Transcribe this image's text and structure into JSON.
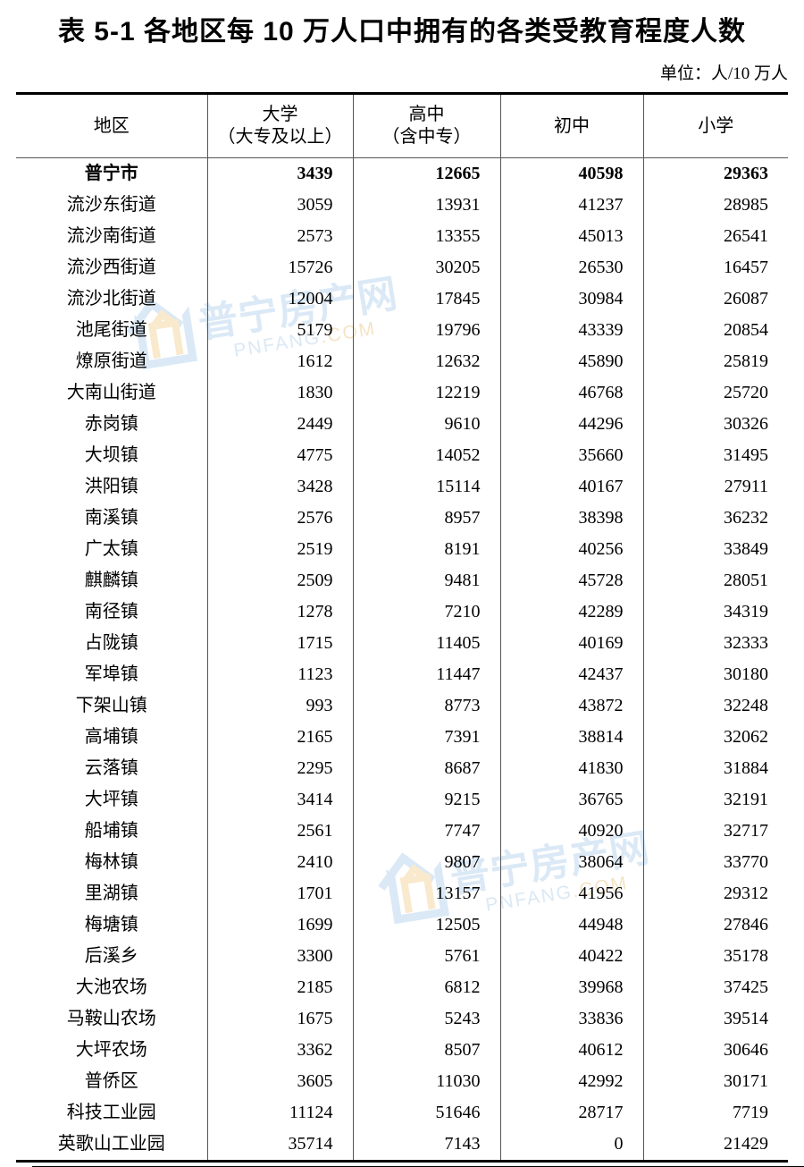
{
  "title": "表 5-1  各地区每 10 万人口中拥有的各类受教育程度人数",
  "unit_note": "单位：人/10 万人",
  "table": {
    "columns": [
      {
        "id": "region",
        "label": "地区",
        "label_line2": ""
      },
      {
        "id": "university",
        "label": "大学",
        "label_line2": "（大专及以上）"
      },
      {
        "id": "high_school",
        "label": "高中",
        "label_line2": "（含中专）"
      },
      {
        "id": "junior_high",
        "label": "初中",
        "label_line2": ""
      },
      {
        "id": "primary",
        "label": "小学",
        "label_line2": ""
      }
    ],
    "rows": [
      {
        "region": "普宁市",
        "university": "3439",
        "high_school": "12665",
        "junior_high": "40598",
        "primary": "29363",
        "emphasis": true
      },
      {
        "region": "流沙东街道",
        "university": "3059",
        "high_school": "13931",
        "junior_high": "41237",
        "primary": "28985"
      },
      {
        "region": "流沙南街道",
        "university": "2573",
        "high_school": "13355",
        "junior_high": "45013",
        "primary": "26541"
      },
      {
        "region": "流沙西街道",
        "university": "15726",
        "high_school": "30205",
        "junior_high": "26530",
        "primary": "16457"
      },
      {
        "region": "流沙北街道",
        "university": "12004",
        "high_school": "17845",
        "junior_high": "30984",
        "primary": "26087"
      },
      {
        "region": "池尾街道",
        "university": "5179",
        "high_school": "19796",
        "junior_high": "43339",
        "primary": "20854"
      },
      {
        "region": "燎原街道",
        "university": "1612",
        "high_school": "12632",
        "junior_high": "45890",
        "primary": "25819"
      },
      {
        "region": "大南山街道",
        "university": "1830",
        "high_school": "12219",
        "junior_high": "46768",
        "primary": "25720"
      },
      {
        "region": "赤岗镇",
        "university": "2449",
        "high_school": "9610",
        "junior_high": "44296",
        "primary": "30326"
      },
      {
        "region": "大坝镇",
        "university": "4775",
        "high_school": "14052",
        "junior_high": "35660",
        "primary": "31495"
      },
      {
        "region": "洪阳镇",
        "university": "3428",
        "high_school": "15114",
        "junior_high": "40167",
        "primary": "27911"
      },
      {
        "region": "南溪镇",
        "university": "2576",
        "high_school": "8957",
        "junior_high": "38398",
        "primary": "36232"
      },
      {
        "region": "广太镇",
        "university": "2519",
        "high_school": "8191",
        "junior_high": "40256",
        "primary": "33849"
      },
      {
        "region": "麒麟镇",
        "university": "2509",
        "high_school": "9481",
        "junior_high": "45728",
        "primary": "28051"
      },
      {
        "region": "南径镇",
        "university": "1278",
        "high_school": "7210",
        "junior_high": "42289",
        "primary": "34319"
      },
      {
        "region": "占陇镇",
        "university": "1715",
        "high_school": "11405",
        "junior_high": "40169",
        "primary": "32333"
      },
      {
        "region": "军埠镇",
        "university": "1123",
        "high_school": "11447",
        "junior_high": "42437",
        "primary": "30180"
      },
      {
        "region": "下架山镇",
        "university": "993",
        "high_school": "8773",
        "junior_high": "43872",
        "primary": "32248"
      },
      {
        "region": "高埔镇",
        "university": "2165",
        "high_school": "7391",
        "junior_high": "38814",
        "primary": "32062"
      },
      {
        "region": "云落镇",
        "university": "2295",
        "high_school": "8687",
        "junior_high": "41830",
        "primary": "31884"
      },
      {
        "region": "大坪镇",
        "university": "3414",
        "high_school": "9215",
        "junior_high": "36765",
        "primary": "32191"
      },
      {
        "region": "船埔镇",
        "university": "2561",
        "high_school": "7747",
        "junior_high": "40920",
        "primary": "32717"
      },
      {
        "region": "梅林镇",
        "university": "2410",
        "high_school": "9807",
        "junior_high": "38064",
        "primary": "33770"
      },
      {
        "region": "里湖镇",
        "university": "1701",
        "high_school": "13157",
        "junior_high": "41956",
        "primary": "29312"
      },
      {
        "region": "梅塘镇",
        "university": "1699",
        "high_school": "12505",
        "junior_high": "44948",
        "primary": "27846"
      },
      {
        "region": "后溪乡",
        "university": "3300",
        "high_school": "5761",
        "junior_high": "40422",
        "primary": "35178"
      },
      {
        "region": "大池农场",
        "university": "2185",
        "high_school": "6812",
        "junior_high": "39968",
        "primary": "37425"
      },
      {
        "region": "马鞍山农场",
        "university": "1675",
        "high_school": "5243",
        "junior_high": "33836",
        "primary": "39514"
      },
      {
        "region": "大坪农场",
        "university": "3362",
        "high_school": "8507",
        "junior_high": "40612",
        "primary": "30646"
      },
      {
        "region": "普侨区",
        "university": "3605",
        "high_school": "11030",
        "junior_high": "42992",
        "primary": "30171"
      },
      {
        "region": "科技工业园",
        "university": "11124",
        "high_school": "51646",
        "junior_high": "28717",
        "primary": "7719"
      },
      {
        "region": "英歌山工业园",
        "university": "35714",
        "high_school": "7143",
        "junior_high": "0",
        "primary": "21429"
      }
    ]
  },
  "watermark": {
    "chinese": "普宁房产网",
    "domain_main": "PNFANG",
    "domain_suffix": ".COM",
    "color_blue": "#cfe2f3",
    "color_tan": "#f1dcb4"
  },
  "chart_data": {
    "type": "table",
    "title": "表 5-1  各地区每 10 万人口中拥有的各类受教育程度人数",
    "subtitle": "单位：人/10 万人",
    "columns": [
      "地区",
      "大学（大专及以上）",
      "高中（含中专）",
      "初中",
      "小学"
    ],
    "categories": [
      "普宁市",
      "流沙东街道",
      "流沙南街道",
      "流沙西街道",
      "流沙北街道",
      "池尾街道",
      "燎原街道",
      "大南山街道",
      "赤岗镇",
      "大坝镇",
      "洪阳镇",
      "南溪镇",
      "广太镇",
      "麒麟镇",
      "南径镇",
      "占陇镇",
      "军埠镇",
      "下架山镇",
      "高埔镇",
      "云落镇",
      "大坪镇",
      "船埔镇",
      "梅林镇",
      "里湖镇",
      "梅塘镇",
      "后溪乡",
      "大池农场",
      "马鞍山农场",
      "大坪农场",
      "普侨区",
      "科技工业园",
      "英歌山工业园"
    ],
    "series": [
      {
        "name": "大学（大专及以上）",
        "values": [
          3439,
          3059,
          2573,
          15726,
          12004,
          5179,
          1612,
          1830,
          2449,
          4775,
          3428,
          2576,
          2519,
          2509,
          1278,
          1715,
          1123,
          993,
          2165,
          2295,
          3414,
          2561,
          2410,
          1701,
          1699,
          3300,
          2185,
          1675,
          3362,
          3605,
          11124,
          35714
        ]
      },
      {
        "name": "高中（含中专）",
        "values": [
          12665,
          13931,
          13355,
          30205,
          17845,
          19796,
          12632,
          12219,
          9610,
          14052,
          15114,
          8957,
          8191,
          9481,
          7210,
          11405,
          11447,
          8773,
          7391,
          8687,
          9215,
          7747,
          9807,
          13157,
          12505,
          5761,
          6812,
          5243,
          8507,
          11030,
          51646,
          7143
        ]
      },
      {
        "name": "初中",
        "values": [
          40598,
          41237,
          45013,
          26530,
          30984,
          43339,
          45890,
          46768,
          44296,
          35660,
          40167,
          38398,
          40256,
          45728,
          42289,
          40169,
          42437,
          43872,
          38814,
          41830,
          36765,
          40920,
          38064,
          41956,
          44948,
          40422,
          39968,
          33836,
          40612,
          42992,
          28717,
          0
        ]
      },
      {
        "name": "小学",
        "values": [
          29363,
          28985,
          26541,
          16457,
          26087,
          20854,
          25819,
          25720,
          30326,
          31495,
          27911,
          36232,
          33849,
          28051,
          34319,
          32333,
          30180,
          32248,
          32062,
          31884,
          32191,
          32717,
          33770,
          29312,
          27846,
          35178,
          37425,
          39514,
          30646,
          30171,
          7719,
          21429
        ]
      }
    ],
    "ylabel": "人/10 万人",
    "xlabel": "地区"
  }
}
